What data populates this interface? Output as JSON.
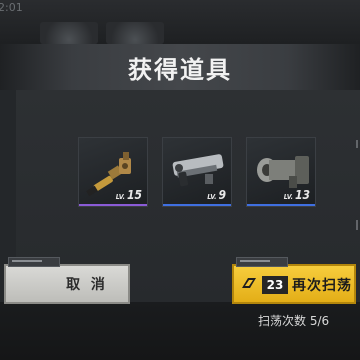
{
  "hud": {
    "timer": "2:01"
  },
  "dialog": {
    "title": "获得道具",
    "items": [
      {
        "name": "rifle-scope-attachment",
        "level_prefix": "LV.",
        "level": "15",
        "rarity_color": "#8a5bd6"
      },
      {
        "name": "pistol-attachment",
        "level_prefix": "LV.",
        "level": "9",
        "rarity_color": "#3f6fe0"
      },
      {
        "name": "barrel-attachment",
        "level_prefix": "LV.",
        "level": "13",
        "rarity_color": "#3f6fe0"
      }
    ],
    "cancel_label": "取 消",
    "sweep_cost": "23",
    "sweep_label": "再次扫荡",
    "sweep_count_label": "扫荡次数 5/6"
  },
  "colors": {
    "accent": "#f2c233",
    "rarity_purple": "#8a5bd6",
    "rarity_blue": "#3f6fe0"
  }
}
